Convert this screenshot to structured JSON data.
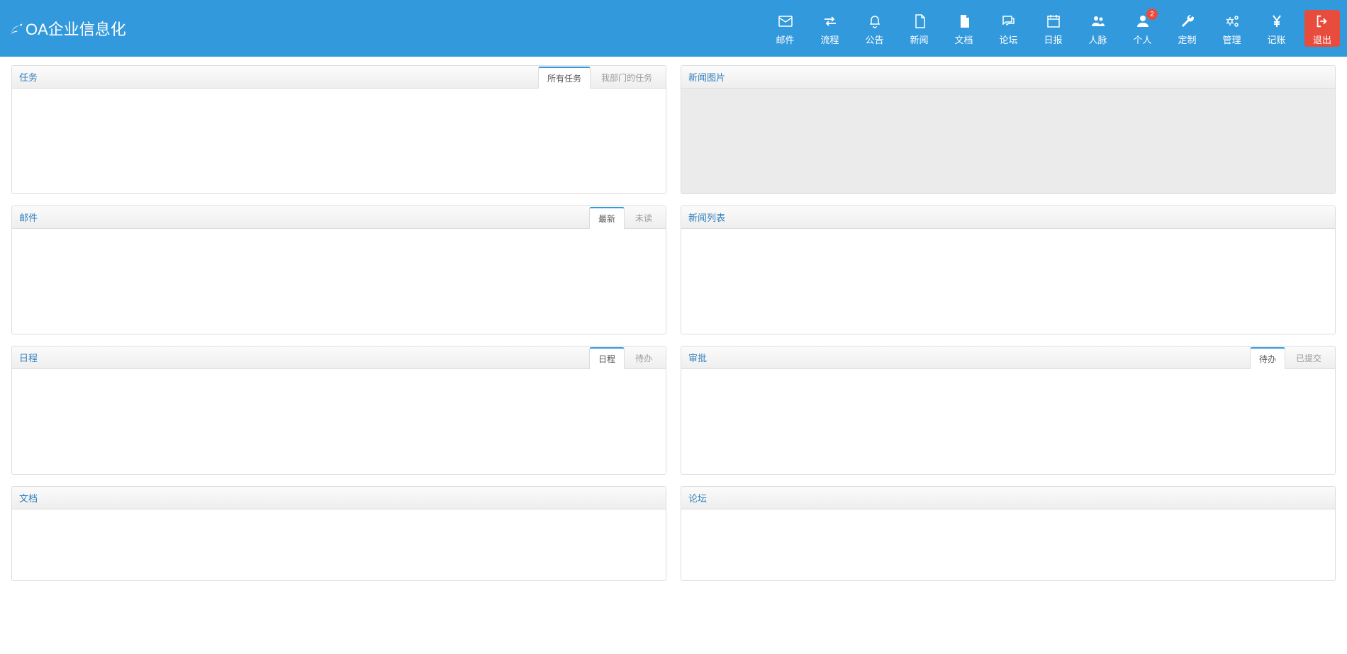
{
  "brand": {
    "title": "OA企业信息化"
  },
  "nav": [
    {
      "label": "邮件",
      "icon": "envelope"
    },
    {
      "label": "流程",
      "icon": "exchange"
    },
    {
      "label": "公告",
      "icon": "bell"
    },
    {
      "label": "新闻",
      "icon": "file-o"
    },
    {
      "label": "文档",
      "icon": "file"
    },
    {
      "label": "论坛",
      "icon": "comments"
    },
    {
      "label": "日报",
      "icon": "calendar"
    },
    {
      "label": "人脉",
      "icon": "users"
    },
    {
      "label": "个人",
      "icon": "user",
      "badge": "2"
    },
    {
      "label": "定制",
      "icon": "wrench"
    },
    {
      "label": "管理",
      "icon": "cogs"
    },
    {
      "label": "记账",
      "icon": "yen"
    }
  ],
  "logout": {
    "label": "退出"
  },
  "panels": {
    "task": {
      "title": "任务",
      "tabs": [
        "所有任务",
        "我部门的任务"
      ],
      "active": 0
    },
    "newsImg": {
      "title": "新闻图片"
    },
    "mail": {
      "title": "邮件",
      "tabs": [
        "最新",
        "未读"
      ],
      "active": 0
    },
    "newsList": {
      "title": "新闻列表"
    },
    "schedule": {
      "title": "日程",
      "tabs": [
        "日程",
        "待办"
      ],
      "active": 0
    },
    "approval": {
      "title": "审批",
      "tabs": [
        "待办",
        "已提交"
      ],
      "active": 0
    },
    "doc": {
      "title": "文档"
    },
    "forum": {
      "title": "论坛"
    }
  }
}
